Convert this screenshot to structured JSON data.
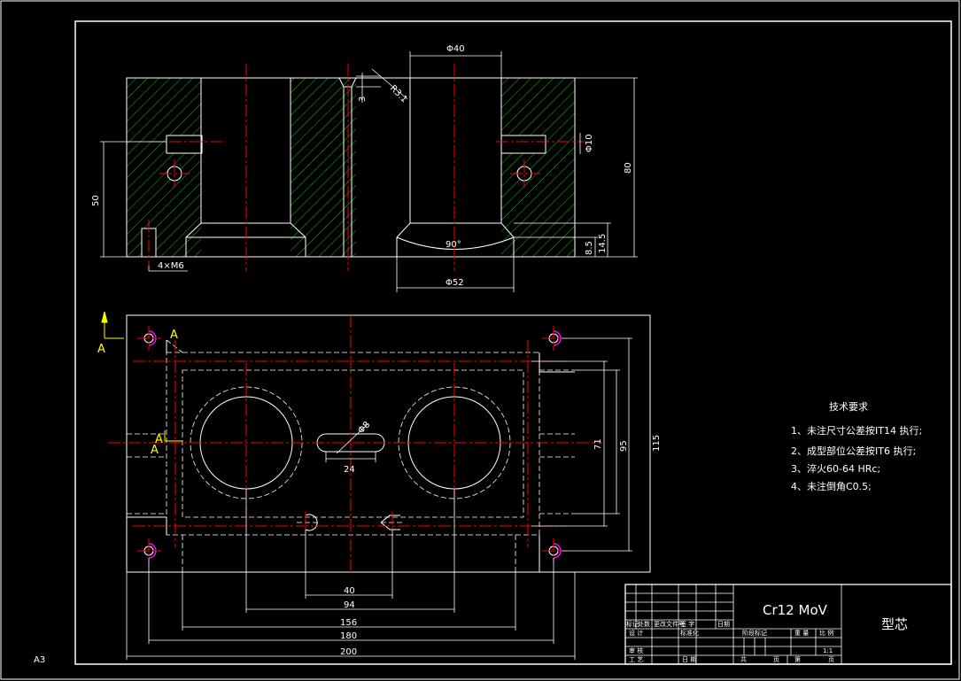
{
  "sheet": {
    "size_label": "A3"
  },
  "front_view": {
    "dims": {
      "phi40": "Φ40",
      "r3_1": "R3.1",
      "three": "3",
      "phi10": "Φ10",
      "h80": "80",
      "h50": "50",
      "h14_5": "14.5",
      "h8_5": "8.5",
      "angle90": "90°",
      "phi52": "Φ52",
      "thread": "4×M6"
    }
  },
  "top_view": {
    "dims": {
      "phi8": "Φ8",
      "w24": "24",
      "w40": "40",
      "w94": "94",
      "w156": "156",
      "w180": "180",
      "w200": "200",
      "h71": "71",
      "h95": "95",
      "h115": "115"
    },
    "section_marks": [
      "A",
      "A",
      "A",
      "A"
    ]
  },
  "technical_requirements": {
    "title": "技术要求",
    "items": [
      "1、未注尺寸公差按IT14 执行;",
      "2、成型部位公差按IT6 执行;",
      "3、淬火60-64 HRc;",
      "4、未注倒角C0.5;"
    ]
  },
  "title_block": {
    "material": "Cr12 MoV",
    "part_name": "型芯",
    "rev_headers": [
      "标记",
      "处数",
      "更改文件号",
      "签 字",
      "日期"
    ],
    "design": "设 计",
    "standard": "标准化",
    "review": "审 核",
    "process": "工 艺",
    "date": "日 期",
    "stage_mark": "阶段标记",
    "weight": "重 量",
    "scale": "比 例",
    "scale_value": "1:1",
    "sheets_total": "共",
    "sheet_unit": "页",
    "sheet_no": "第",
    "sheet_unit2": "页"
  },
  "colors": {
    "outline": "#ffffff",
    "centerline": "#ff0000",
    "hatch": "#00cc00",
    "hidden": "#ffffff",
    "section_mark": "#ffff00",
    "thread_circle": "#ff00ff"
  }
}
